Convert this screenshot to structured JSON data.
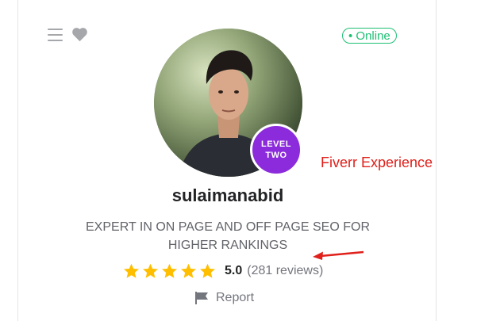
{
  "status": {
    "online_label": "• Online"
  },
  "seller": {
    "username": "sulaimanabid",
    "level_line1": "LEVEL",
    "level_line2": "TWO",
    "tagline": "EXPERT IN ON PAGE AND OFF PAGE SEO FOR HIGHER RANKINGS",
    "rating": "5.0",
    "reviews": "(281 reviews)",
    "stars": 5
  },
  "actions": {
    "report_label": "Report"
  },
  "annotation": {
    "text": "Fiverr Experience"
  },
  "icons": {
    "menu": "menu-icon",
    "heart": "heart-icon",
    "star": "star-icon",
    "flag": "flag-icon"
  },
  "colors": {
    "online_green": "#1dbf73",
    "level_purple": "#8b2bdb",
    "star_gold": "#ffbe00",
    "annotation_red": "#e0201b",
    "icon_gray": "#a6a7ab"
  }
}
